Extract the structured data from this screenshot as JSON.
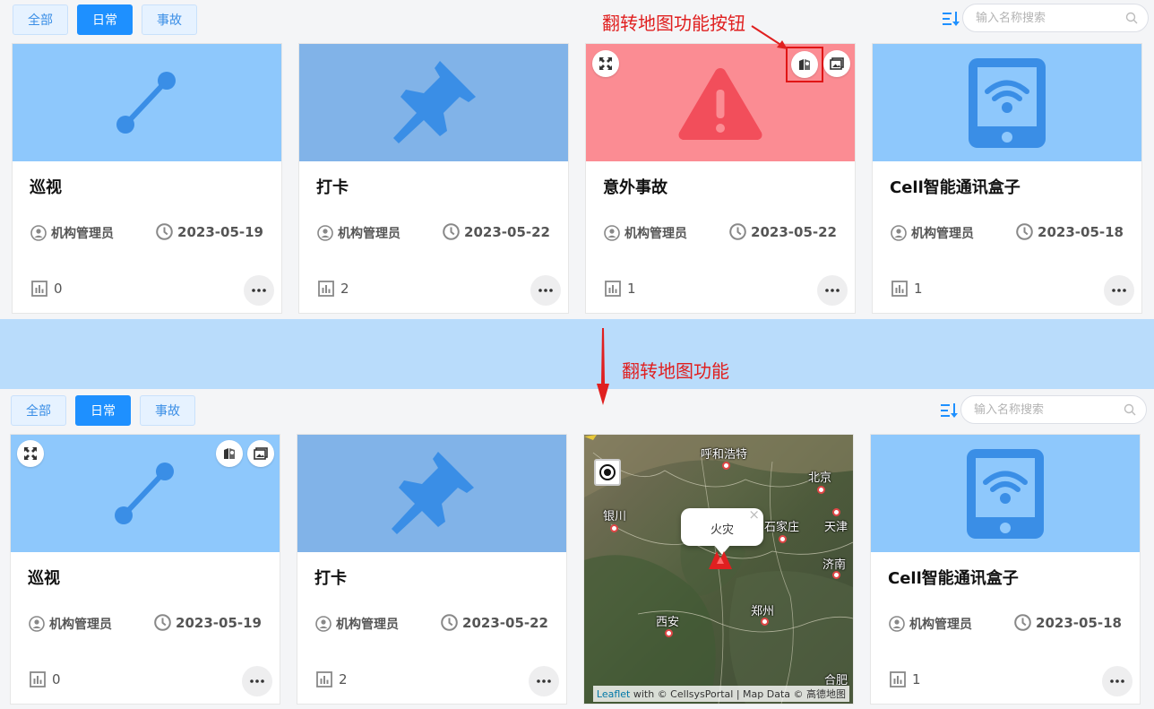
{
  "filters": [
    {
      "label": "全部",
      "active": false
    },
    {
      "label": "日常",
      "active": true
    },
    {
      "label": "事故",
      "active": false
    }
  ],
  "search": {
    "placeholder": "输入名称搜索"
  },
  "annotations": {
    "flip_button": "翻转地图功能按钮",
    "flip_feature": "翻转地图功能"
  },
  "cards": [
    {
      "title": "巡视",
      "owner": "机构管理员",
      "date": "2023-05-19",
      "count": "0",
      "icon": "route-line-icon"
    },
    {
      "title": "打卡",
      "owner": "机构管理员",
      "date": "2023-05-22",
      "count": "2",
      "icon": "pushpin-icon"
    },
    {
      "title": "意外事故",
      "owner": "机构管理员",
      "date": "2023-05-22",
      "count": "1",
      "icon": "warning-triangle-icon"
    },
    {
      "title": "Cell智能通讯盒子",
      "owner": "机构管理员",
      "date": "2023-05-18",
      "count": "1",
      "icon": "tablet-wifi-icon"
    }
  ],
  "map": {
    "popup_text": "火灾",
    "cities": [
      {
        "name": "呼和浩特"
      },
      {
        "name": "北京"
      },
      {
        "name": "银川"
      },
      {
        "name": "石家庄"
      },
      {
        "name": "天津"
      },
      {
        "name": "济南"
      },
      {
        "name": "西安"
      },
      {
        "name": "郑州"
      },
      {
        "name": "合肥"
      }
    ],
    "attribution_leaflet": "Leaflet",
    "attribution_rest": " with © CellsysPortal | Map Data © 高德地图"
  },
  "colors": {
    "primary": "#1e90ff",
    "annotation_red": "#e02020",
    "media_blue": "#8ec8fc",
    "media_red": "#fb8c93"
  }
}
